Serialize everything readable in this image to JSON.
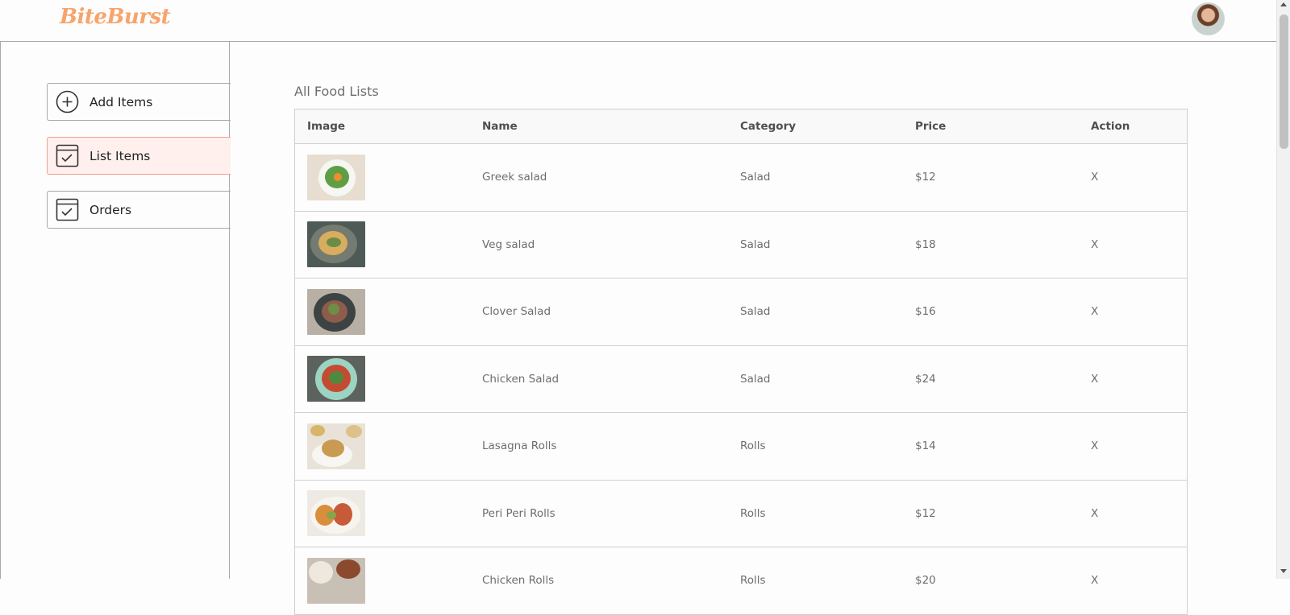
{
  "brand": {
    "name": "BiteBurst",
    "accent": "#f7a46b",
    "active_bg": "#fff0ed"
  },
  "sidebar": {
    "items": [
      {
        "label": "Add Items",
        "icon": "add-circle-icon",
        "active": false
      },
      {
        "label": "List Items",
        "icon": "checklist-icon",
        "active": true
      },
      {
        "label": "Orders",
        "icon": "checklist-icon",
        "active": false
      }
    ]
  },
  "main": {
    "title": "All Food Lists",
    "table": {
      "headers": [
        "Image",
        "Name",
        "Category",
        "Price",
        "Action"
      ],
      "rows": [
        {
          "name": "Greek salad",
          "category": "Salad",
          "price": "$12",
          "action": "X"
        },
        {
          "name": "Veg salad",
          "category": "Salad",
          "price": "$18",
          "action": "X"
        },
        {
          "name": "Clover Salad",
          "category": "Salad",
          "price": "$16",
          "action": "X"
        },
        {
          "name": "Chicken Salad",
          "category": "Salad",
          "price": "$24",
          "action": "X"
        },
        {
          "name": "Lasagna Rolls",
          "category": "Rolls",
          "price": "$14",
          "action": "X"
        },
        {
          "name": "Peri Peri Rolls",
          "category": "Rolls",
          "price": "$12",
          "action": "X"
        },
        {
          "name": "Chicken Rolls",
          "category": "Rolls",
          "price": "$20",
          "action": "X"
        }
      ]
    }
  }
}
